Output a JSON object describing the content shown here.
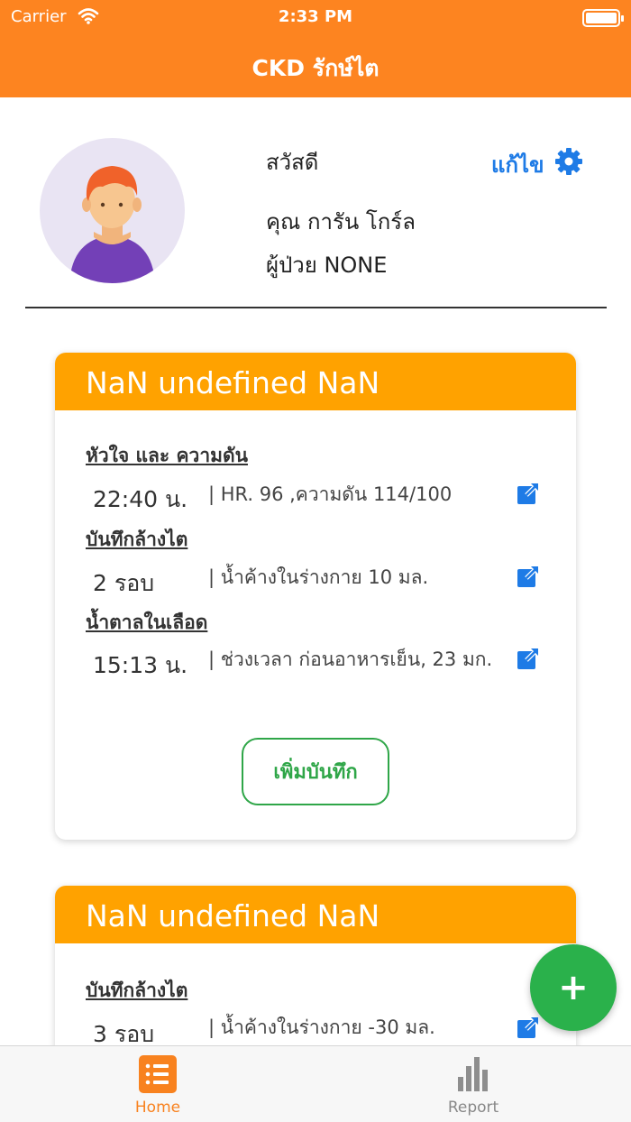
{
  "status_bar": {
    "carrier": "Carrier",
    "time": "2:33 PM"
  },
  "header": {
    "title": "CKD รักษ์ไต"
  },
  "profile": {
    "greeting": "สวัสดี",
    "name": "คุณ การัน โกร์ล",
    "patient_id": "ผู้ป่วย NONE",
    "edit_label": "แก้ไข"
  },
  "cards": [
    {
      "date": "NaN undefined NaN",
      "add_record_label": "เพิ่มบันทึก",
      "entries": [
        {
          "section": "หัวใจ และ ความดัน",
          "value": "22:40 น.",
          "detail": "| HR. 96 ,ความดัน 114/100"
        },
        {
          "section": "บันทึกล้างไต",
          "value": "2 รอบ",
          "detail": "| น้ำค้างในร่างกาย 10 มล."
        },
        {
          "section": "น้ำตาลในเลือด",
          "value": "15:13 น.",
          "detail": "| ช่วงเวลา ก่อนอาหารเย็น, 23 มก."
        }
      ]
    },
    {
      "date": "NaN undefined NaN",
      "entries": [
        {
          "section": "บันทึกล้างไต",
          "value": "3 รอบ",
          "detail": "| น้ำค้างในร่างกาย -30 มล."
        }
      ]
    }
  ],
  "fab": {
    "label": "+"
  },
  "tabs": [
    {
      "label": "Home",
      "icon": "list-icon",
      "active": true
    },
    {
      "label": "Report",
      "icon": "bar-chart-icon",
      "active": false
    }
  ],
  "colors": {
    "primary": "#fd8420",
    "card_header": "#ffa200",
    "accent_blue": "#1e7be6",
    "green": "#2ab14b"
  }
}
